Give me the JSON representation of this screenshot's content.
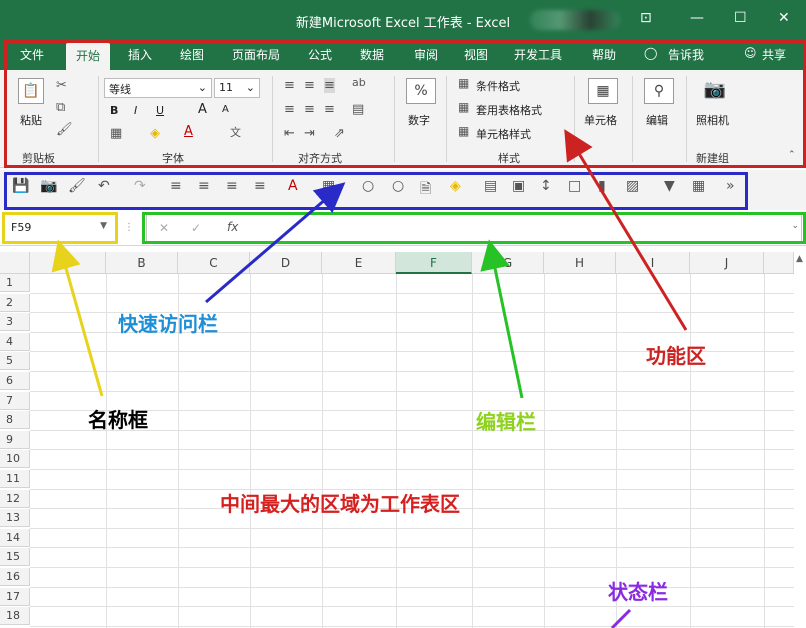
{
  "window": {
    "title": "新建Microsoft Excel 工作表 - Excel",
    "controls": [
      "⊡",
      "—",
      "☐",
      "✕"
    ]
  },
  "tabs": [
    "文件",
    "开始",
    "插入",
    "绘图",
    "页面布局",
    "公式",
    "数据",
    "审阅",
    "视图",
    "开发工具",
    "帮助"
  ],
  "tell_me": "告诉我",
  "share": "共享",
  "ribbon": {
    "clipboard": {
      "paste": "粘贴",
      "label": "剪贴板"
    },
    "font": {
      "name": "等线",
      "size": "11",
      "bold": "B",
      "italic": "I",
      "underline": "U",
      "grow": "A",
      "shrink": "A",
      "label": "字体"
    },
    "alignment": {
      "label": "对齐方式"
    },
    "number": {
      "button": "数字",
      "symbol": "%"
    },
    "styles": {
      "conditional": "条件格式",
      "table": "套用表格格式",
      "cell": "单元格样式",
      "label": "样式"
    },
    "cells": {
      "button": "单元格"
    },
    "editing": {
      "button": "编辑"
    },
    "camera": {
      "button": "照相机",
      "label": "新建组"
    }
  },
  "name_box": "F59",
  "formula_icons": {
    "cancel": "✕",
    "enter": "✓",
    "fx": "fx"
  },
  "columns": [
    "B",
    "C",
    "D",
    "E",
    "F",
    "G",
    "H",
    "I",
    "J"
  ],
  "selected_column": "F",
  "rows": [
    "1",
    "2",
    "3",
    "4",
    "5",
    "6",
    "7",
    "8",
    "9",
    "10",
    "11",
    "12",
    "13",
    "14",
    "15",
    "16",
    "17",
    "18"
  ],
  "annotations": {
    "quick_access": "快速访问栏",
    "ribbon": "功能区",
    "name_box": "名称框",
    "formula_bar": "编辑栏",
    "worksheet": "中间最大的区域为工作表区",
    "status_bar": "状态栏"
  },
  "colors": {
    "excel_green": "#217346",
    "ribbon_frame": "#cc2222",
    "qat_frame": "#2a2ac8",
    "namebox_frame": "#e8d31c",
    "formula_frame": "#26c226",
    "status_arrow": "#8a2be2"
  }
}
